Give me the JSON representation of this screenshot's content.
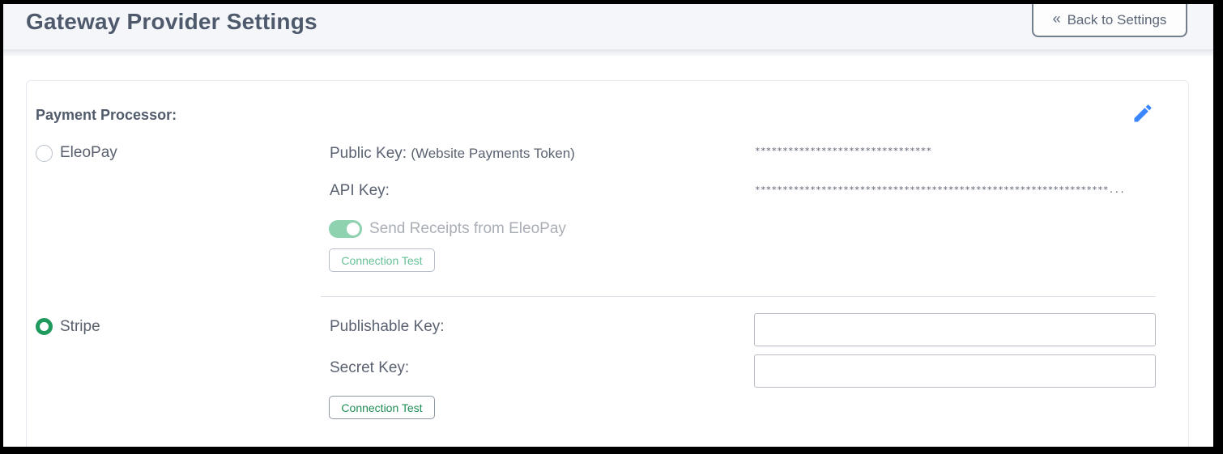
{
  "header": {
    "title": "Gateway Provider Settings",
    "back_label": "Back to Settings",
    "back_icon": "double-chevron-left-icon"
  },
  "card": {
    "section_label": "Payment Processor:",
    "edit_icon": "pencil-icon",
    "edit_icon_color": "#3a86ff"
  },
  "eleopay": {
    "name": "EleoPay",
    "selected": false,
    "public_key_label": "Public Key:",
    "public_key_sublabel": "(Website Payments Token)",
    "public_key_value": "********************************",
    "api_key_label": "API Key:",
    "api_key_value": "****************************************************************...",
    "receipts_toggle_label": "Send Receipts from EleoPay",
    "receipts_toggle_on": true,
    "connection_test_label": "Connection Test"
  },
  "stripe": {
    "name": "Stripe",
    "selected": true,
    "publishable_key_label": "Publishable Key:",
    "publishable_key_value": "",
    "secret_key_label": "Secret Key:",
    "secret_key_value": "",
    "connection_test_label": "Connection Test"
  },
  "colors": {
    "accent_green": "#1f9a5c",
    "toggle_on": "#8fd2b0",
    "title_text": "#4e5a6c"
  }
}
